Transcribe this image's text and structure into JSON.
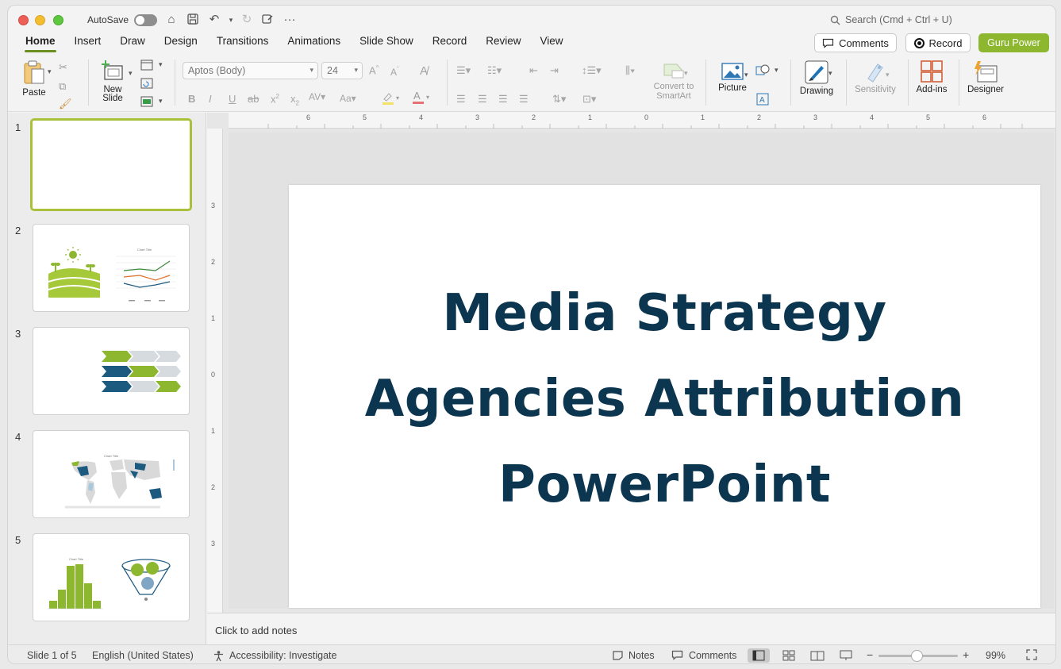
{
  "titlebar": {
    "autosave_label": "AutoSave",
    "search_placeholder": "Search (Cmd + Ctrl + U)"
  },
  "tabs": [
    {
      "label": "Home",
      "active": true
    },
    {
      "label": "Insert"
    },
    {
      "label": "Draw"
    },
    {
      "label": "Design"
    },
    {
      "label": "Transitions"
    },
    {
      "label": "Animations"
    },
    {
      "label": "Slide Show"
    },
    {
      "label": "Record"
    },
    {
      "label": "Review"
    },
    {
      "label": "View"
    }
  ],
  "header_buttons": {
    "comments": "Comments",
    "record": "Record",
    "guru": "Guru Power"
  },
  "ribbon": {
    "paste": "Paste",
    "new_slide_line1": "New",
    "new_slide_line2": "Slide",
    "font_name": "Aptos (Body)",
    "font_size": "24",
    "convert_line1": "Convert to",
    "convert_line2": "SmartArt",
    "picture": "Picture",
    "drawing": "Drawing",
    "sensitivity": "Sensitivity",
    "addins": "Add-ins",
    "designer": "Designer"
  },
  "thumbnails": [
    {
      "number": "1",
      "selected": true
    },
    {
      "number": "2",
      "chart_title": "Chart Title"
    },
    {
      "number": "3"
    },
    {
      "number": "4",
      "chart_title": "Chart Title"
    },
    {
      "number": "5",
      "chart_title": "Chart Title"
    }
  ],
  "slide": {
    "title_line1": "Media Strategy",
    "title_line2": "Agencies Attribution",
    "title_line3": "PowerPoint",
    "title_color": "#0c3550"
  },
  "notes_placeholder": "Click to add notes",
  "ruler": {
    "top_ticks": [
      "6",
      "5",
      "4",
      "3",
      "2",
      "1",
      "0",
      "1",
      "2",
      "3",
      "4",
      "5",
      "6"
    ],
    "left_ticks": [
      "3",
      "2",
      "1",
      "0",
      "1",
      "2",
      "3"
    ]
  },
  "statusbar": {
    "slide_info": "Slide 1 of 5",
    "language": "English (United States)",
    "accessibility": "Accessibility: Investigate",
    "notes": "Notes",
    "comments": "Comments",
    "zoom": "99%"
  },
  "colors": {
    "accent_green": "#8cb72f",
    "dark_blue": "#1d5a80",
    "title_navy": "#0c3550"
  }
}
